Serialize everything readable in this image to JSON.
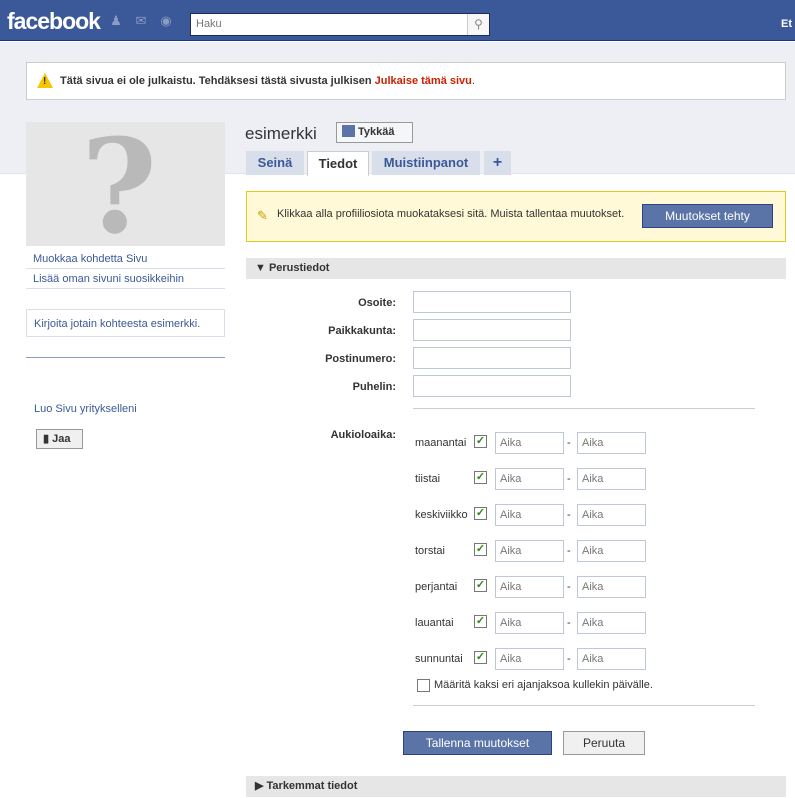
{
  "topbar": {
    "logo": "facebook",
    "search_placeholder": "Haku",
    "right_label": "Et"
  },
  "notice": {
    "text": "Tätä sivua ei ole julkaistu. Tehdäksesi tästä sivusta julkisen",
    "link": "Julkaise tämä sivu",
    "end": "."
  },
  "left": {
    "links": [
      "Muokkaa kohdetta Sivu",
      "Lisää oman sivuni suosikkeihin"
    ],
    "write_prompt": "Kirjoita jotain kohteesta esimerkki.",
    "create_page": "Luo Sivu yritykselleni",
    "share_label": "Jaa"
  },
  "page": {
    "name": "esimerkki",
    "like_label": "Tykkää"
  },
  "tabs": [
    "Seinä",
    "Tiedot",
    "Muistiinpanot",
    "+"
  ],
  "info": {
    "text": "Klikkaa alla profiiliosiota muokataksesi sitä. Muista tallentaa muutokset.",
    "done_button": "Muutokset tehty"
  },
  "basic": {
    "header": "▼ Perustiedot",
    "fields": [
      "Osoite:",
      "Paikkakunta:",
      "Postinumero:",
      "Puhelin:"
    ],
    "hours_label": "Aukioloaika:",
    "days": [
      "maanantai",
      "tiistai",
      "keskiviikko",
      "torstai",
      "perjantai",
      "lauantai",
      "sunnuntai"
    ],
    "time_placeholder": "Aika",
    "dash": "-",
    "two_periods": "Määritä kaksi eri ajanjaksoa kullekin päivälle.",
    "save": "Tallenna muutokset",
    "cancel": "Peruuta"
  },
  "more": {
    "header": "▶ Tarkemmat tiedot"
  }
}
